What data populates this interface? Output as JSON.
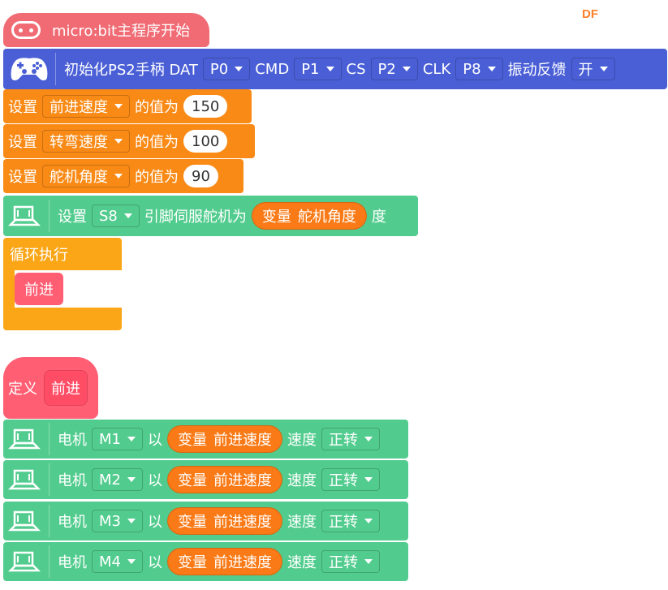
{
  "watermark": "DF",
  "start_hat": {
    "label": "micro:bit主程序开始"
  },
  "ps2_init": {
    "label": "初始化PS2手柄 DAT",
    "dat_value": "P0",
    "cmd_label": "CMD",
    "cmd_value": "P1",
    "cs_label": "CS",
    "cs_value": "P2",
    "clk_label": "CLK",
    "clk_value": "P8",
    "vibration_label": "振动反馈",
    "vibration_value": "开"
  },
  "set_blocks": [
    {
      "set_label": "设置",
      "variable": "前进速度",
      "of_label": "的值为",
      "value": "150"
    },
    {
      "set_label": "设置",
      "variable": "转弯速度",
      "of_label": "的值为",
      "value": "100"
    },
    {
      "set_label": "设置",
      "variable": "舵机角度",
      "of_label": "的值为",
      "value": "90"
    }
  ],
  "servo_block": {
    "set_label": "设置",
    "pin_value": "S8",
    "pin_label": "引脚伺服舵机为",
    "var_keyword": "变量",
    "var_name": "舵机角度",
    "unit_label": "度"
  },
  "loop": {
    "label": "循环执行",
    "call_label": "前进"
  },
  "define": {
    "label": "定义",
    "name": "前进"
  },
  "motors": [
    {
      "motor_label": "电机",
      "motor_value": "M1",
      "with_label": "以",
      "var_keyword": "变量",
      "var_name": "前进速度",
      "speed_label": "速度",
      "dir_value": "正转"
    },
    {
      "motor_label": "电机",
      "motor_value": "M2",
      "with_label": "以",
      "var_keyword": "变量",
      "var_name": "前进速度",
      "speed_label": "速度",
      "dir_value": "正转"
    },
    {
      "motor_label": "电机",
      "motor_value": "M3",
      "with_label": "以",
      "var_keyword": "变量",
      "var_name": "前进速度",
      "speed_label": "速度",
      "dir_value": "正转"
    },
    {
      "motor_label": "电机",
      "motor_value": "M4",
      "with_label": "以",
      "var_keyword": "变量",
      "var_name": "前进速度",
      "speed_label": "速度",
      "dir_value": "正转"
    }
  ],
  "colors": {
    "hat_red": "#f06b74",
    "ps2_blue": "#4a5fd6",
    "variables_orange": "#f98a16",
    "loop_yellow": "#fba617",
    "motor_green": "#52cc8e",
    "function_pink": "#ff5e73"
  }
}
